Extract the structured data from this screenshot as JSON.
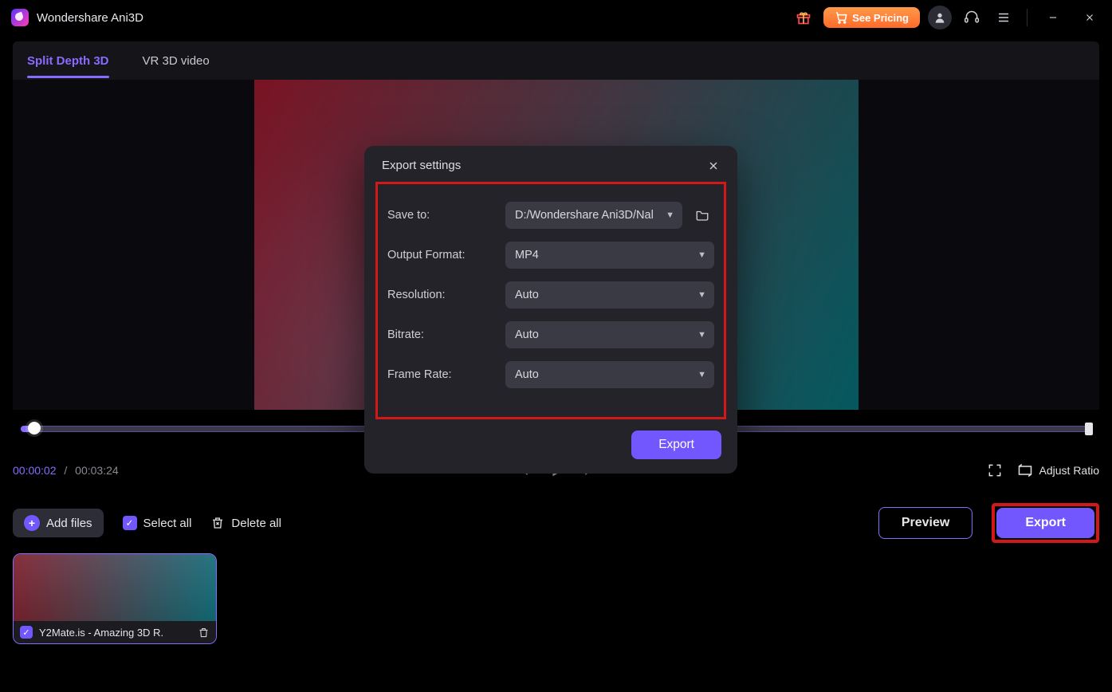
{
  "app": {
    "title": "Wondershare Ani3D"
  },
  "titlebar": {
    "see_pricing": "See Pricing"
  },
  "tabs": {
    "split_depth": "Split Depth 3D",
    "vr_3d": "VR 3D video"
  },
  "transport": {
    "current_time": "00:00:02",
    "separator": "/",
    "duration": "00:03:24",
    "adjust_ratio": "Adjust Ratio"
  },
  "file_actions": {
    "add_files": "Add files",
    "select_all": "Select all",
    "delete_all": "Delete all",
    "preview": "Preview",
    "export": "Export"
  },
  "thumbnails": [
    {
      "name": "Y2Mate.is - Amazing 3D R.",
      "selected": true
    }
  ],
  "export_dialog": {
    "title": "Export settings",
    "labels": {
      "save_to": "Save to:",
      "output_format": "Output Format:",
      "resolution": "Resolution:",
      "bitrate": "Bitrate:",
      "frame_rate": "Frame Rate:"
    },
    "values": {
      "save_to": "D:/Wondershare Ani3D/Nal",
      "output_format": "MP4",
      "resolution": "Auto",
      "bitrate": "Auto",
      "frame_rate": "Auto"
    },
    "export_label": "Export"
  }
}
